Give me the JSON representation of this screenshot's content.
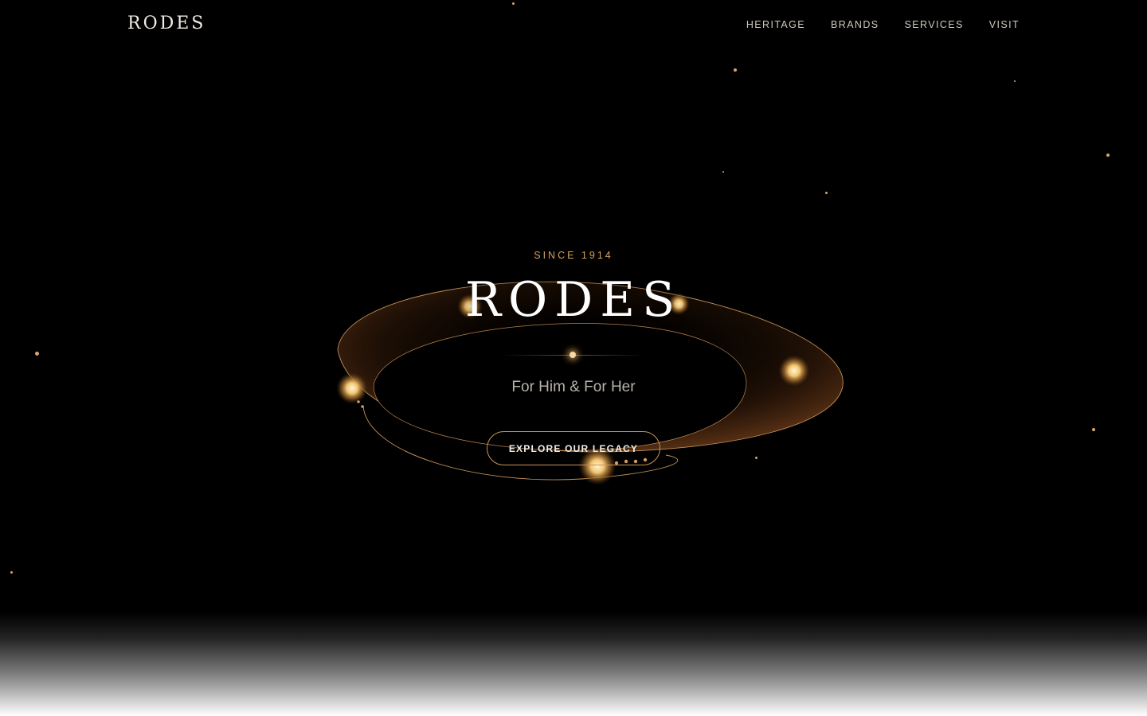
{
  "nav": {
    "logo": "RODES",
    "links": [
      "HERITAGE",
      "BRANDS",
      "SERVICES",
      "VISIT"
    ]
  },
  "hero": {
    "eyebrow": "SINCE 1914",
    "title": "RODES",
    "tagline": "For Him & For Her",
    "cta_label": "EXPLORE OUR LEGACY"
  },
  "colors": {
    "background": "#000000",
    "accent_gold": "#d4a05e",
    "text_light": "#f1ece3"
  }
}
